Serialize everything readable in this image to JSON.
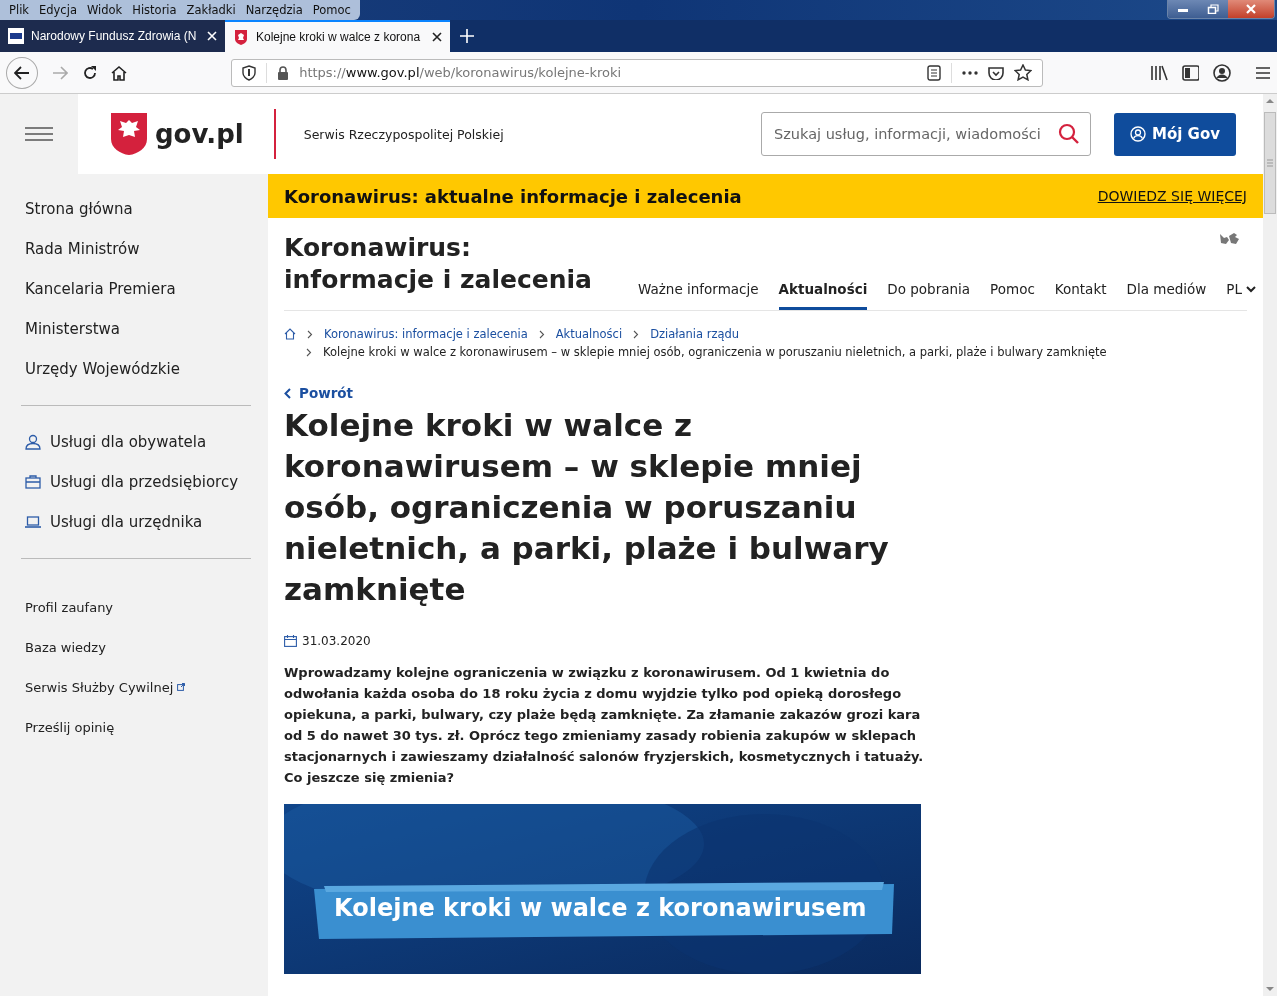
{
  "browser": {
    "menu": [
      "Plik",
      "Edycja",
      "Widok",
      "Historia",
      "Zakładki",
      "Narzędzia",
      "Pomoc"
    ],
    "tabs": [
      {
        "title": "Narodowy Fundusz Zdrowia (N",
        "selected": false
      },
      {
        "title": "Kolejne kroki w walce z korona",
        "selected": true
      }
    ],
    "url": {
      "scheme": "https://",
      "host": "www.gov.pl",
      "path": "/web/koronawirus/kolejne-kroki"
    }
  },
  "header": {
    "logo": "gov.pl",
    "tagline": "Serwis Rzeczypospolitej Polskiej",
    "search": {
      "placeholder": "Szukaj usług, informacji, wiadomości"
    },
    "account_button": "Mój Gov"
  },
  "banner": {
    "text": "Koronawirus: aktualne informacje i zalecenia",
    "link": "DOWIEDZ SIĘ WIĘCEJ"
  },
  "sidebar": {
    "primary": [
      "Strona główna",
      "Rada Ministrów",
      "Kancelaria Premiera",
      "Ministerstwa",
      "Urzędy Wojewódzkie"
    ],
    "services": [
      {
        "label": "Usługi dla obywatela",
        "kind": "person"
      },
      {
        "label": "Usługi dla przedsiębiorcy",
        "kind": "briefcase"
      },
      {
        "label": "Usługi dla urzędnika",
        "kind": "laptop"
      }
    ],
    "secondary": [
      {
        "label": "Profil zaufany",
        "external": false
      },
      {
        "label": "Baza wiedzy",
        "external": false
      },
      {
        "label": "Serwis Służby Cywilnej",
        "external": true
      },
      {
        "label": "Prześlij opinię",
        "external": false
      }
    ]
  },
  "section": {
    "title": "Koronawirus: informacje i zalecenia",
    "tabs": [
      {
        "label": "Ważne informacje",
        "selected": false
      },
      {
        "label": "Aktualności",
        "selected": true
      },
      {
        "label": "Do pobrania",
        "selected": false
      },
      {
        "label": "Pomoc",
        "selected": false
      },
      {
        "label": "Kontakt",
        "selected": false
      },
      {
        "label": "Dla mediów",
        "selected": false
      }
    ],
    "language": "PL"
  },
  "breadcrumb": {
    "items": [
      "Koronawirus: informacje i zalecenia",
      "Aktualności",
      "Działania rządu"
    ],
    "current": "Kolejne kroki w walce z koronawirusem – w sklepie mniej osób, ograniczenia w poruszaniu nieletnich, a parki, plaże i bulwary zamknięte"
  },
  "article": {
    "back_link": "Powrót",
    "title": "Kolejne kroki w walce z koronawirusem – w sklepie mniej osób, ograniczenia w poruszaniu nieletnich, a parki, plaże i bulwary zamknięte",
    "date": "31.03.2020",
    "lead": "Wprowadzamy kolejne ograniczenia w związku z koronawirusem. Od 1 kwietnia do odwołania każda osoba do 18 roku życia z domu wyjdzie tylko pod opieką dorosłego opiekuna, a parki, bulwary, czy plaże będą zamknięte. Za złamanie zakazów grozi kara od 5 do nawet 30 tys. zł. Oprócz tego zmieniamy zasady robienia zakupów w sklepach stacjonarnych i zawieszamy działalność salonów fryzjerskich, kosmetycznych i tatuaży. Co jeszcze się zmienia?",
    "hero": {
      "kind": "picture",
      "caption": "Kolejne kroki w walce z koronawirusem"
    }
  }
}
